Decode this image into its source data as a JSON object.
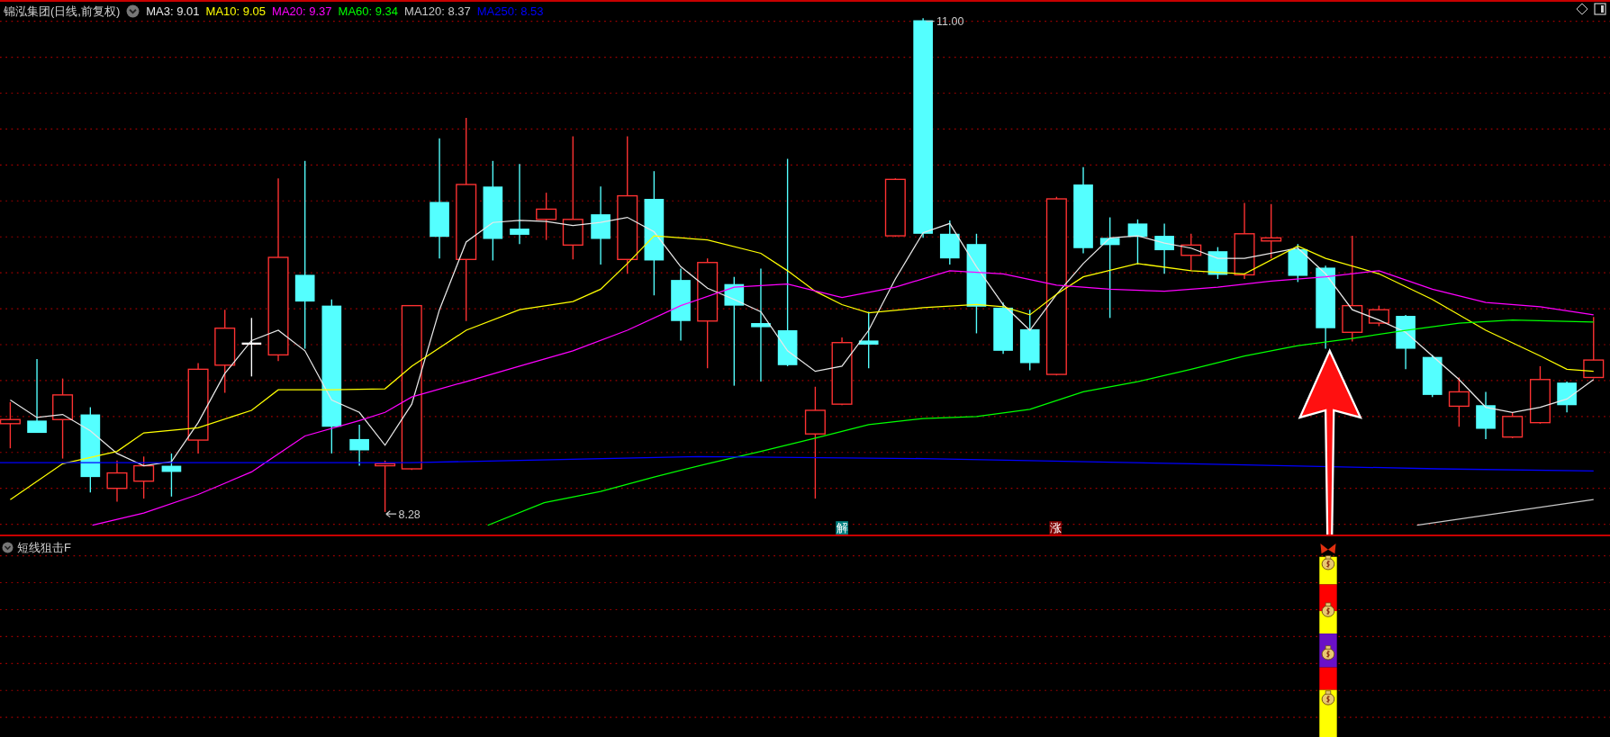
{
  "legend": {
    "title": "锦泓集团(日线,前复权)",
    "items": [
      {
        "label": "MA3: 9.01",
        "color": "#e8e8e8"
      },
      {
        "label": "MA10: 9.05",
        "color": "#ffff00"
      },
      {
        "label": "MA20: 9.37",
        "color": "#ff00ff"
      },
      {
        "label": "MA60: 9.34",
        "color": "#00ff00"
      },
      {
        "label": "MA120: 8.37",
        "color": "#c8c8c8"
      },
      {
        "label": "MA250: 8.53",
        "color": "#0000ff"
      }
    ]
  },
  "price_chart": {
    "high_label": "11.00",
    "low_label": "8.28",
    "markers": [
      {
        "text": "解",
        "color": "#007f7f"
      },
      {
        "text": "涨",
        "color": "#7f0000"
      }
    ]
  },
  "indicator_panel": {
    "title": "短线狙击F"
  }
}
